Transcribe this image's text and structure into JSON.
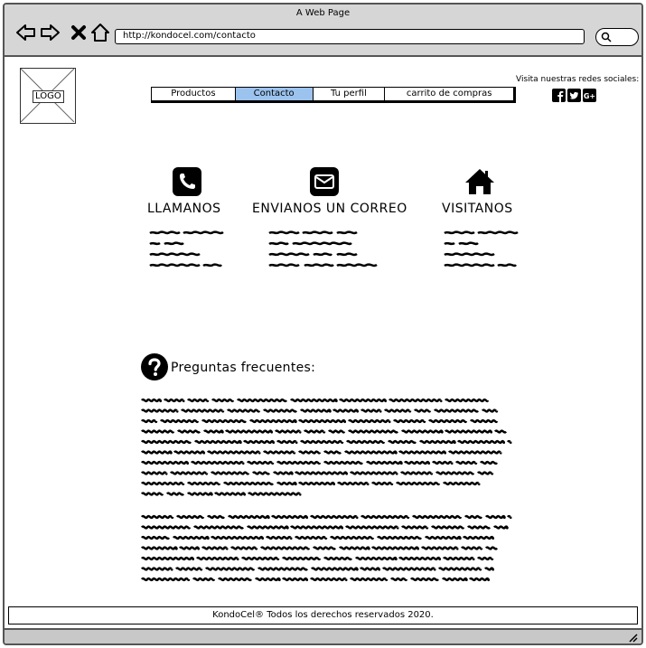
{
  "browser": {
    "title": "A Web Page",
    "url": "http://kondocel.com/contacto"
  },
  "header": {
    "logo_label": "LOGO",
    "menu": [
      {
        "label": "Productos",
        "active": false
      },
      {
        "label": "Contacto",
        "active": true
      },
      {
        "label": "Tu perfil",
        "active": false
      },
      {
        "label": "carrito de compras",
        "active": false
      }
    ],
    "social_label": "Visita nuestras redes sociales:",
    "social_icons": [
      "facebook-icon",
      "twitter-icon",
      "google-plus-icon"
    ]
  },
  "contact": {
    "call_title": "LLAMANOS",
    "email_title": "ENVIANOS UN CORREO",
    "visit_title": "VISITANOS"
  },
  "faq": {
    "title": "Preguntas frecuentes:"
  },
  "footer": {
    "text": "KondoCel® Todos los derechos reservados 2020."
  },
  "colors": {
    "active_menu": "#9cc3ee",
    "chrome": "#d6d6d6"
  }
}
